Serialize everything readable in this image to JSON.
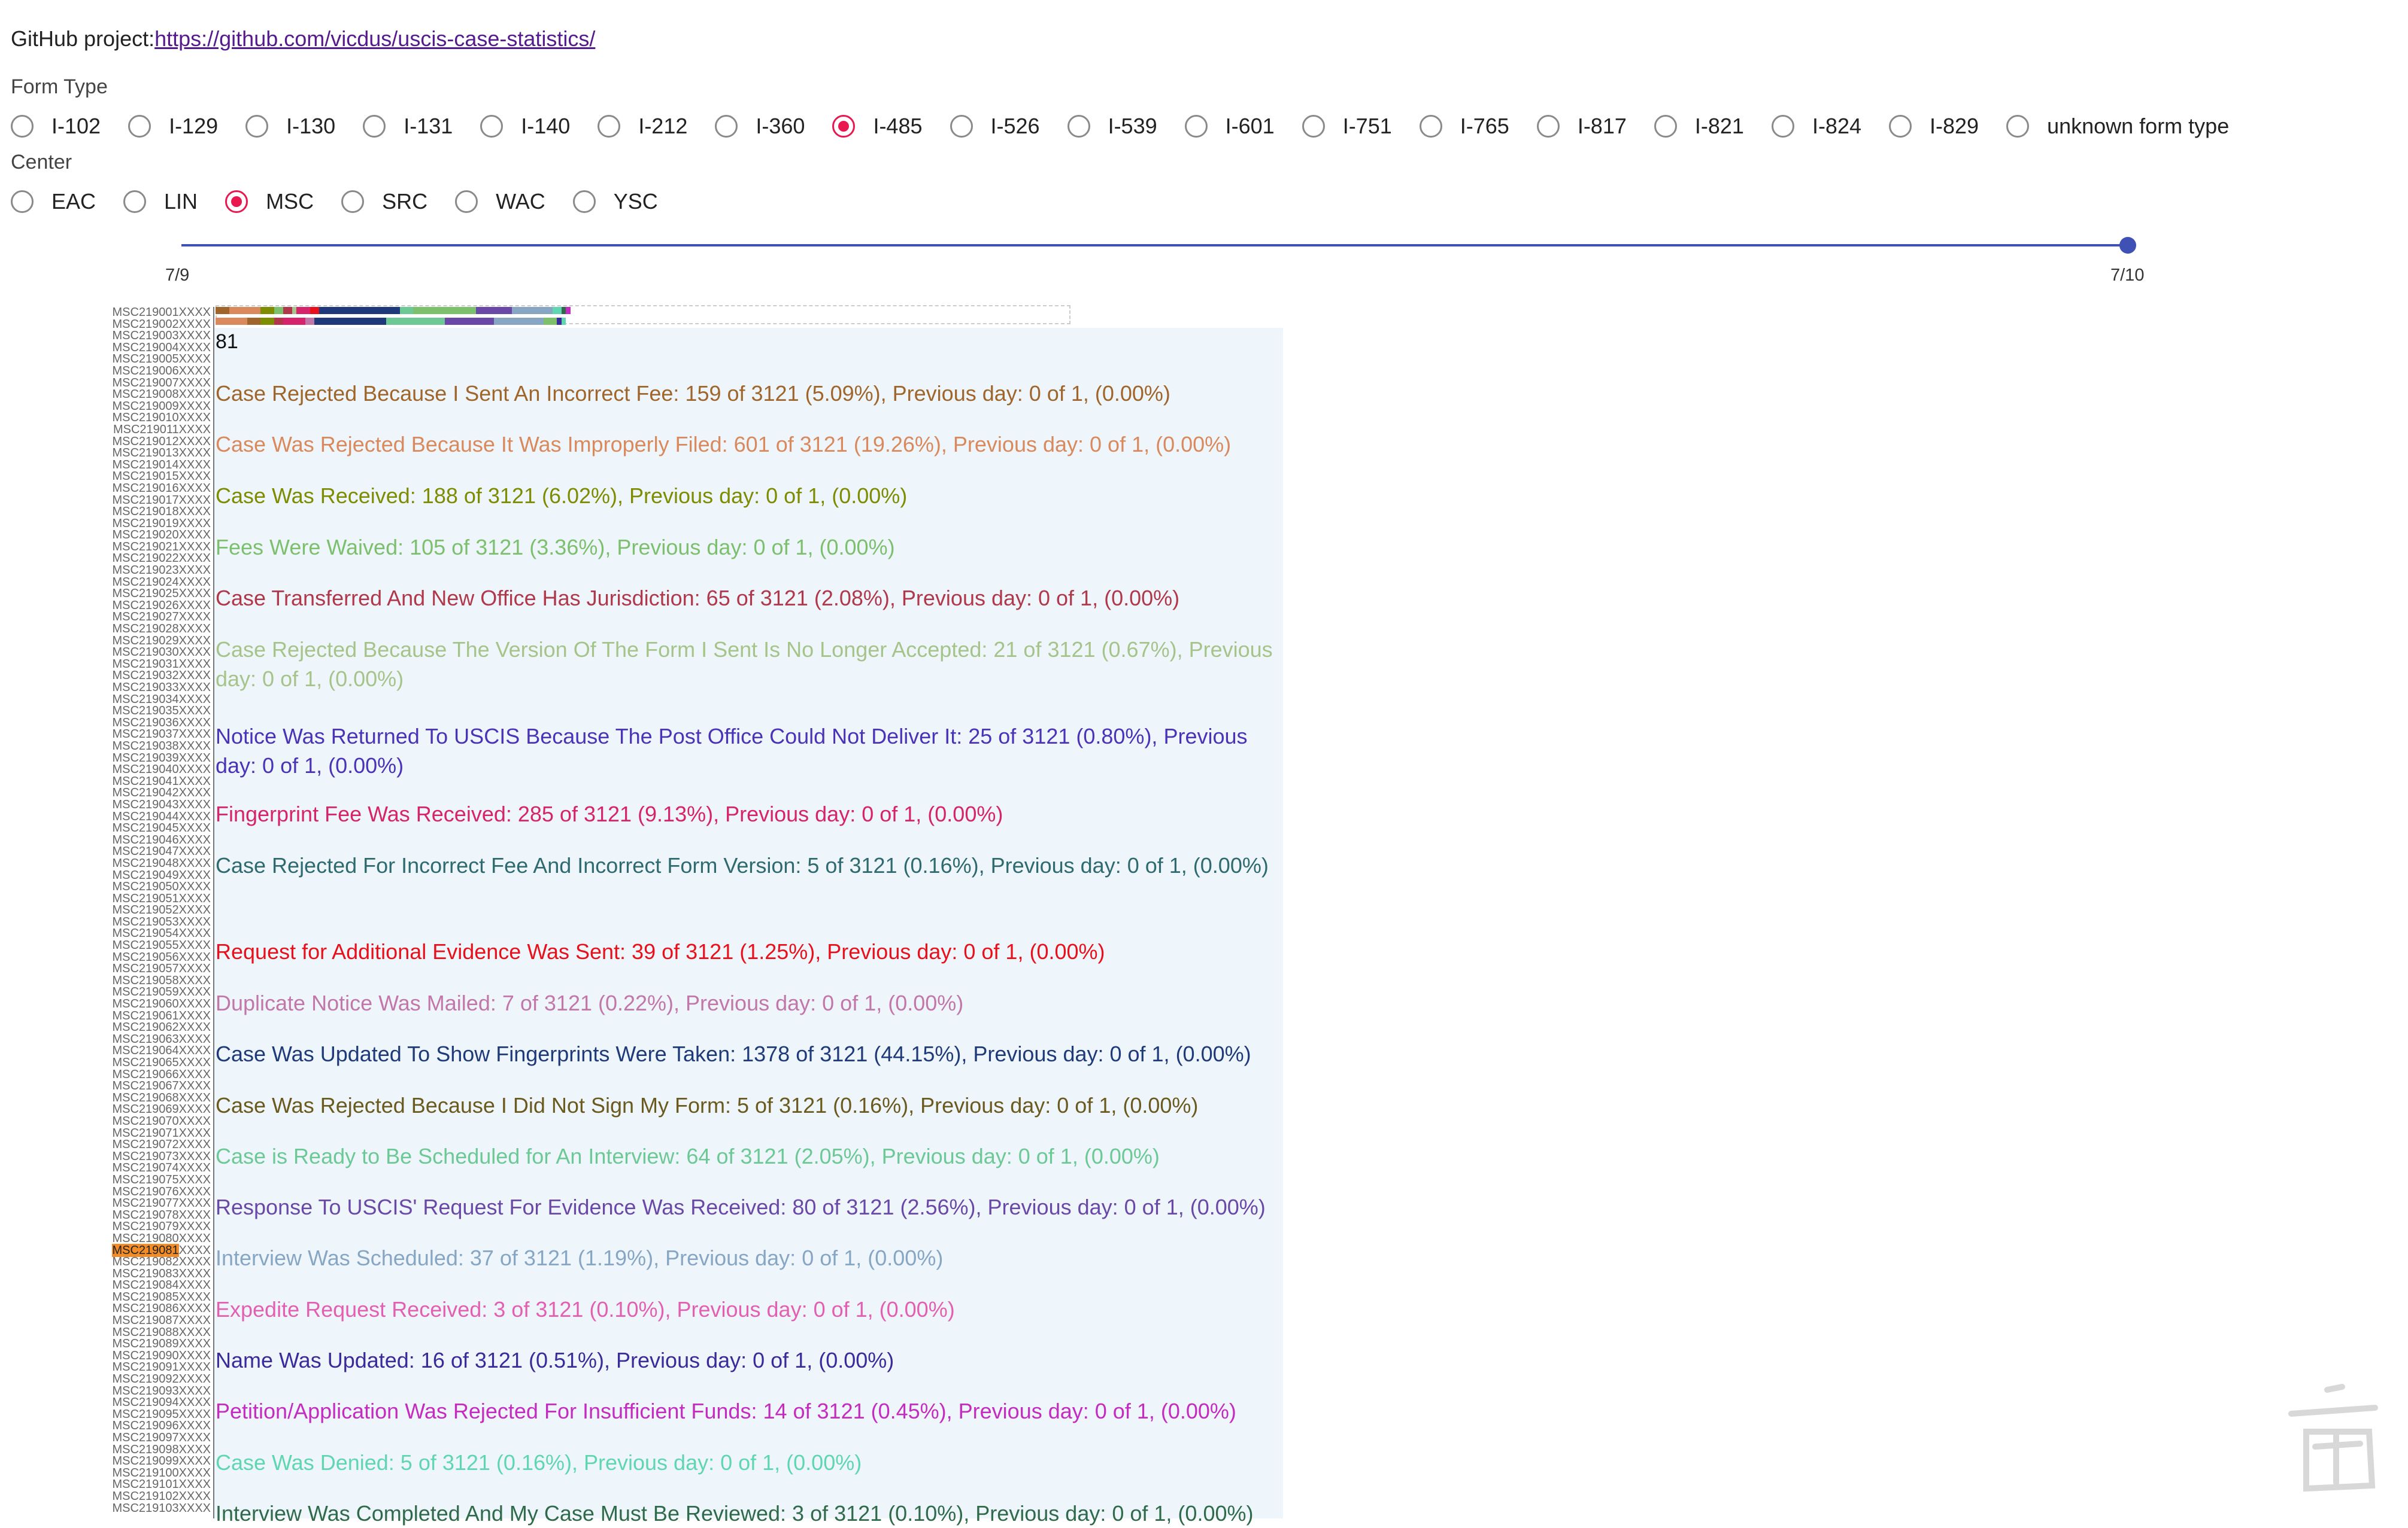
{
  "header": {
    "prefix": "GitHub project:",
    "link": "https://github.com/vicdus/uscis-case-statistics/"
  },
  "form_type": {
    "label": "Form Type",
    "options": [
      "I-102",
      "I-129",
      "I-130",
      "I-131",
      "I-140",
      "I-212",
      "I-360",
      "I-485",
      "I-526",
      "I-539",
      "I-601",
      "I-751",
      "I-765",
      "I-817",
      "I-821",
      "I-824",
      "I-829",
      "unknown form type"
    ],
    "selected": "I-485"
  },
  "center": {
    "label": "Center",
    "options": [
      "EAC",
      "LIN",
      "MSC",
      "SRC",
      "WAC",
      "YSC"
    ],
    "selected": "MSC"
  },
  "slider": {
    "start_label": "7/9",
    "end_label": "7/10",
    "value_label": "7/10"
  },
  "case_ids": {
    "prefix": "MSC219",
    "suffix": "XXXX",
    "first": 1,
    "last": 103,
    "highlighted": "MSC219081"
  },
  "tooltip": {
    "count": "81",
    "items": [
      {
        "text": "Case Rejected Because I Sent An Incorrect Fee: 159 of 3121 (5.09%), Previous day: 0 of 1, (0.00%)",
        "color": "#a0652a"
      },
      {
        "text": "Case Was Rejected Because It Was Improperly Filed: 601 of 3121 (19.26%), Previous day: 0 of 1, (0.00%)",
        "color": "#d9895c"
      },
      {
        "text": "Case Was Received: 188 of 3121 (6.02%), Previous day: 0 of 1, (0.00%)",
        "color": "#7d8c00"
      },
      {
        "text": "Fees Were Waived: 105 of 3121 (3.36%), Previous day: 0 of 1, (0.00%)",
        "color": "#7cbf6c"
      },
      {
        "text": "Case Transferred And New Office Has Jurisdiction: 65 of 3121 (2.08%), Previous day: 0 of 1, (0.00%)",
        "color": "#b0384a"
      },
      {
        "text": "Case Rejected Because The Version Of The Form I Sent Is No Longer Accepted: 21 of 3121 (0.67%), Previous day: 0 of 1, (0.00%)",
        "color": "#a6c48a"
      },
      {
        "text": "Notice Was Returned To USCIS Because The Post Office Could Not Deliver It: 25 of 3121 (0.80%), Previous day: 0 of 1, (0.00%)",
        "color": "#4b33b8"
      },
      {
        "text": "Fingerprint Fee Was Received: 285 of 3121 (9.13%), Previous day: 0 of 1, (0.00%)",
        "color": "#d6246c"
      },
      {
        "text": "Case Rejected For Incorrect Fee And Incorrect Form Version: 5 of 3121 (0.16%), Previous day: 0 of 1, (0.00%)",
        "color": "#2e6a6e"
      },
      {
        "text": "Request for Additional Evidence Was Sent: 39 of 3121 (1.25%), Previous day: 0 of 1, (0.00%)",
        "color": "#e8101a"
      },
      {
        "text": "Duplicate Notice Was Mailed: 7 of 3121 (0.22%), Previous day: 0 of 1, (0.00%)",
        "color": "#c277a8"
      },
      {
        "text": "Case Was Updated To Show Fingerprints Were Taken: 1378 of 3121 (44.15%), Previous day: 0 of 1, (0.00%)",
        "color": "#1f3a7a"
      },
      {
        "text": "Case Was Rejected Because I Did Not Sign My Form: 5 of 3121 (0.16%), Previous day: 0 of 1, (0.00%)",
        "color": "#6b5a1e"
      },
      {
        "text": "Case is Ready to Be Scheduled for An Interview: 64 of 3121 (2.05%), Previous day: 0 of 1, (0.00%)",
        "color": "#6cc995"
      },
      {
        "text": "Response To USCIS' Request For Evidence Was Received: 80 of 3121 (2.56%), Previous day: 0 of 1, (0.00%)",
        "color": "#6a48a8"
      },
      {
        "text": "Interview Was Scheduled: 37 of 3121 (1.19%), Previous day: 0 of 1, (0.00%)",
        "color": "#86a6c4"
      },
      {
        "text": "Expedite Request Received: 3 of 3121 (0.10%), Previous day: 0 of 1, (0.00%)",
        "color": "#e35fb2"
      },
      {
        "text": "Name Was Updated: 16 of 3121 (0.51%), Previous day: 0 of 1, (0.00%)",
        "color": "#3a2a9a"
      },
      {
        "text": "Petition/Application Was Rejected For Insufficient Funds: 14 of 3121 (0.45%), Previous day: 0 of 1, (0.00%)",
        "color": "#c42bc0"
      },
      {
        "text": "Case Was Denied: 5 of 3121 (0.16%), Previous day: 0 of 1, (0.00%)",
        "color": "#5fd6b0"
      },
      {
        "text": "Interview Was Completed And My Case Must Be Reviewed: 3 of 3121 (0.10%), Previous day: 0 of 1, (0.00%)",
        "color": "#2f6b4a"
      }
    ]
  },
  "bars": [
    {
      "segments": [
        [
          "#a0652a",
          3
        ],
        [
          "#d9895c",
          7
        ],
        [
          "#7d8c00",
          3
        ],
        [
          "#7cbf6c",
          2
        ],
        [
          "#b0384a",
          2
        ],
        [
          "#a6c48a",
          1
        ],
        [
          "#d6246c",
          3
        ],
        [
          "#e8101a",
          2
        ],
        [
          "#1f3a7a",
          18
        ],
        [
          "#6cc995",
          3
        ],
        [
          "#7cbf6c",
          14
        ],
        [
          "#6a48a8",
          8
        ],
        [
          "#86a6c4",
          9
        ],
        [
          "#5fd6b0",
          2
        ],
        [
          "#2f6b4a",
          1
        ],
        [
          "#c42bc0",
          1
        ]
      ]
    },
    {
      "segments": [
        [
          "#d9895c",
          7
        ],
        [
          "#a0652a",
          3
        ],
        [
          "#7d8c00",
          3
        ],
        [
          "#b0384a",
          2
        ],
        [
          "#d6246c",
          5
        ],
        [
          "#c277a8",
          2
        ],
        [
          "#1f3a7a",
          16
        ],
        [
          "#6cc995",
          13
        ],
        [
          "#6a48a8",
          11
        ],
        [
          "#86a6c4",
          11
        ],
        [
          "#7cbf6c",
          3
        ],
        [
          "#3a2a9a",
          1
        ],
        [
          "#5fd6b0",
          1
        ]
      ]
    }
  ]
}
